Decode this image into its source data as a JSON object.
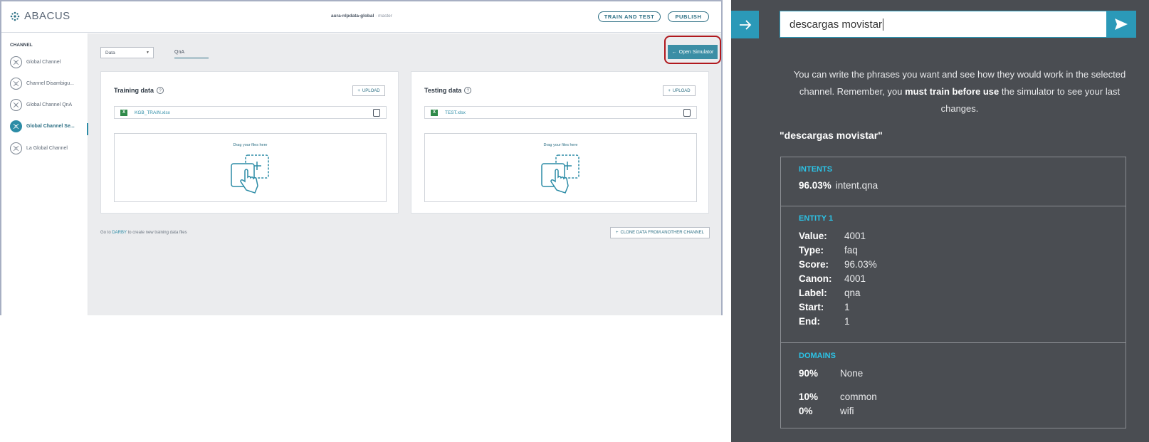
{
  "app": {
    "brand": "ABACUS",
    "project_name": "aura-nlpdata-global",
    "project_sep": " · ",
    "project_branch": "master",
    "train_test_label": "TRAIN AND TEST",
    "publish_label": "PUBLISH"
  },
  "sidebar": {
    "section_title": "CHANNEL",
    "items": [
      {
        "label": "Global Channel"
      },
      {
        "label": "Channel Disambigu..."
      },
      {
        "label": "Global Channel QnA"
      },
      {
        "label": "Global Channel Se..."
      },
      {
        "label": "La Global Channel"
      }
    ],
    "active_index": 3
  },
  "main": {
    "dropdown_value": "Data",
    "tab_label": "QnA",
    "open_simulator_label": "Open Simulator",
    "training": {
      "title": "Training data",
      "upload_label": "UPLOAD",
      "file_name": "KGB_TRAIN.xlsx",
      "drop_text": "Drag your files here"
    },
    "testing": {
      "title": "Testing data",
      "upload_label": "UPLOAD",
      "file_name": "TEST.xlsx",
      "drop_text": "Drag your files here"
    },
    "footer_pre": "Go to ",
    "footer_link": "DARBY",
    "footer_post": " to create new training data files",
    "clone_label": "CLONE DATA FROM ANOTHER CHANNEL"
  },
  "simulator": {
    "input_value": "descargas movistar",
    "help_pre": "You can write the phrases you want and see how they would work in the selected channel. Remember, you ",
    "help_bold": "must train before use",
    "help_post": " the simulator to see your last changes.",
    "phrase": "\"descargas movistar\"",
    "intents": {
      "title": "INTENTS",
      "score": "96.03%",
      "name": "intent.qna"
    },
    "entity": {
      "title": "ENTITY 1",
      "rows": [
        {
          "key": "Value:",
          "value": "4001"
        },
        {
          "key": "Type:",
          "value": "faq"
        },
        {
          "key": "Score:",
          "value": "96.03%"
        },
        {
          "key": "Canon:",
          "value": "4001"
        },
        {
          "key": "Label:",
          "value": "qna"
        },
        {
          "key": "Start:",
          "value": "1"
        },
        {
          "key": "End:",
          "value": "1"
        }
      ]
    },
    "domains": {
      "title": "DOMAINS",
      "rows": [
        {
          "pct": "90%",
          "name": "None"
        },
        {
          "pct": "10%",
          "name": "common"
        },
        {
          "pct": "0%",
          "name": "wifi"
        }
      ]
    }
  },
  "colors": {
    "accent": "#2b99b8",
    "highlight_border": "#b0181d",
    "sim_bg": "#4a4d52",
    "section_head": "#2cc3e6"
  }
}
